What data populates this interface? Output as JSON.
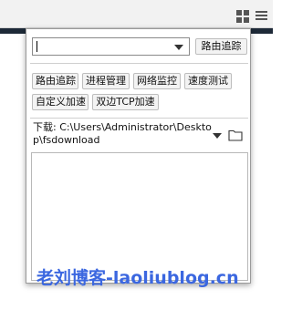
{
  "toolbar": {
    "extension_icon": "grid-icon",
    "menu_icon": "hamburger-menu-icon"
  },
  "popup": {
    "route_select": {
      "value": "",
      "trace_button_label": "路由追踪"
    },
    "tool_buttons": [
      "路由追踪",
      "进程管理",
      "网络监控",
      "速度测试",
      "自定义加速",
      "双边TCP加速"
    ],
    "download": {
      "label": "下载: C:\\Users\\Administrator\\Desktop\\fsdownload",
      "folder_icon": "folder-icon"
    },
    "log_area": ""
  },
  "watermark": "老刘博客-laoliublog.cn",
  "colors": {
    "watermark": "#3b67e0",
    "dark_bar": "#1e2a38"
  }
}
